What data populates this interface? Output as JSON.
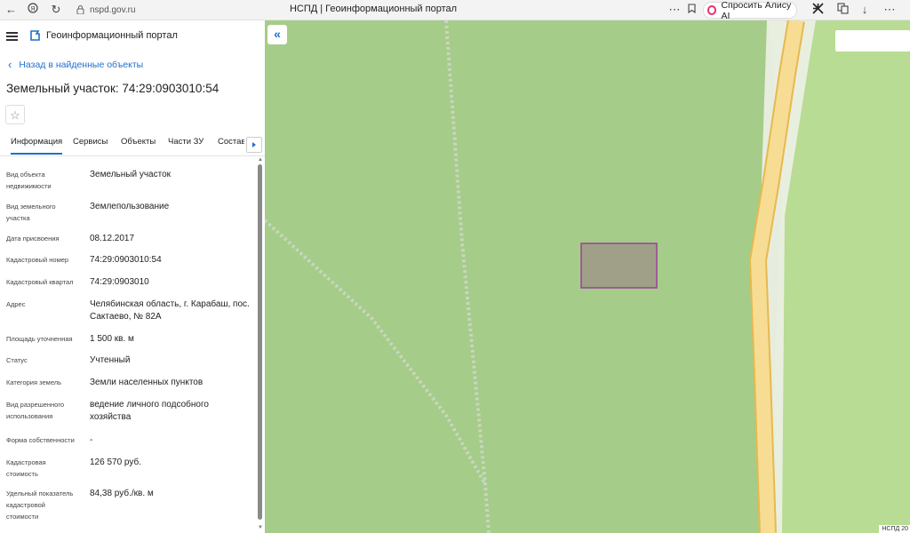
{
  "browser": {
    "url": "nspd.gov.ru",
    "tab_title": "НСПД | Геоинформационный портал",
    "alice_label": "Спросить Алису AI"
  },
  "app": {
    "title": "Геоинформационный портал",
    "back_label": "Назад в найденные объекты",
    "object_title": "Земельный участок: 74:29:0903010:54"
  },
  "tabs": [
    "Информация",
    "Сервисы",
    "Объекты",
    "Части ЗУ",
    "Состав"
  ],
  "properties": [
    {
      "label": "Вид объекта недвижимости",
      "value": "Земельный участок"
    },
    {
      "label": "Вид земельного участка",
      "value": "Землепользование"
    },
    {
      "label": "Дата присвоения",
      "value": "08.12.2017"
    },
    {
      "label": "Кадастровый номер",
      "value": "74:29:0903010:54"
    },
    {
      "label": "Кадастровый квартал",
      "value": "74:29:0903010"
    },
    {
      "label": "Адрес",
      "value": "Челябинская область, г. Карабаш, пос. Сактаево, № 82А"
    },
    {
      "label": "Площадь уточненная",
      "value": "1 500 кв. м"
    },
    {
      "label": "Статус",
      "value": "Учтенный"
    },
    {
      "label": "Категория земель",
      "value": "Земли населенных пунктов"
    },
    {
      "label": "Вид разрешенного использования",
      "value": "ведение личного подсобного хозяйства"
    },
    {
      "label": "Форма собственности",
      "value": "-"
    },
    {
      "label": "Кадастровая стоимость",
      "value": "126 570 руб."
    },
    {
      "label": "Удельный показатель кадастровой стоимости",
      "value": "84,38 руб./кв. м"
    }
  ],
  "map": {
    "credit": "НСПД 20",
    "colors": {
      "land": "#a5cc88",
      "road": "#f7dc94",
      "parcel_fill": "#a0a088",
      "parcel_border": "#9b3f99",
      "accent": "#1f6fd0"
    }
  }
}
